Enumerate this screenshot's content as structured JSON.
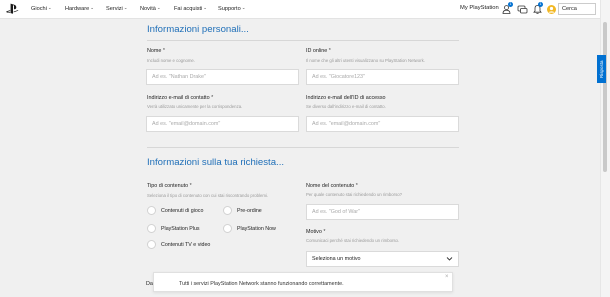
{
  "nav": {
    "items": [
      {
        "label": "Giochi"
      },
      {
        "label": "Hardware"
      },
      {
        "label": "Servizi"
      },
      {
        "label": "Novità"
      },
      {
        "label": "Fai acquisti"
      },
      {
        "label": "Supporto"
      }
    ],
    "my_playstation": "My PlayStation",
    "badges": {
      "friends": "1",
      "messages": "",
      "notifications": "1"
    },
    "search_label": "Cerca"
  },
  "side_tab": "Risposta",
  "personal": {
    "title": "Informazioni personali...",
    "name_label": "Nome",
    "name_help": "Includi nome e cognome.",
    "name_placeholder": "Ad es. \"Nathan Drake\"",
    "online_id_label": "ID online",
    "online_id_help": "Il nome che gli altri utenti visualizzano su PlayStation Network.",
    "online_id_placeholder": "Ad es. \"Giocatore123\"",
    "email_label": "Indirizzo e-mail di contatto",
    "email_help": "Verrà utilizzato unicamente per la corrispondenza.",
    "email_placeholder": "Ad es. \"email@domain.com\"",
    "account_email_label": "Indirizzo e-mail dell'ID di accesso",
    "account_email_help": "Se diverso dall'indirizzo e-mail di contatto.",
    "account_email_placeholder": "Ad es. \"email@domain.com\"",
    "required_mark": "*"
  },
  "request": {
    "title": "Informazioni sulla tua richiesta...",
    "content_type_label": "Tipo di contenuto",
    "content_type_help": "Seleziona il tipo di contenuto con cui stai riscontrando problemi.",
    "options": [
      {
        "label": "Contenuti di gioco"
      },
      {
        "label": "Pre-ordine"
      },
      {
        "label": "PlayStation Plus"
      },
      {
        "label": "PlayStation Now"
      },
      {
        "label": "Contenuti TV e video"
      }
    ],
    "content_name_label": "Nome del contenuto",
    "content_name_help": "Per quale contenuto stai richiedendo un rimborso?",
    "content_name_placeholder": "Ad es. \"God of War\"",
    "reason_label": "Motivo",
    "reason_help": "Comunicaci perché stai richiedendo un rimborso.",
    "reason_selected": "Seleziona un motivo",
    "cut_label": "Da"
  },
  "toast": {
    "message": "Tutti i servizi PlayStation Network stanno funzionando correttamente.",
    "close": "×"
  },
  "colors": {
    "accent": "#0070d1",
    "section_title": "#1f6fb8"
  }
}
